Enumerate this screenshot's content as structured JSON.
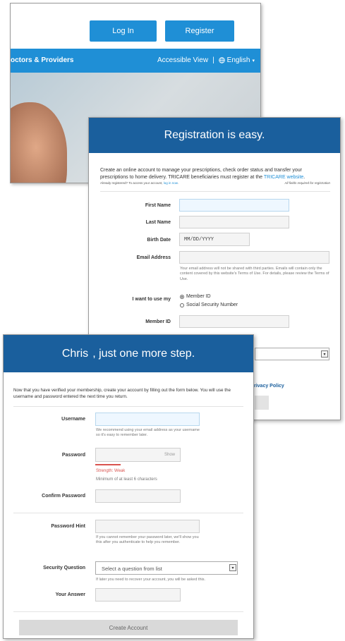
{
  "header": {
    "login_label": "Log In",
    "register_label": "Register",
    "nav_left": "octors & Providers",
    "accessible_view": "Accessible View",
    "separator": "|",
    "language": "English",
    "globe_icon": "globe-icon",
    "caret_icon": "caret-down-icon",
    "brand_color": "#1f8fd6"
  },
  "registration": {
    "title": "Registration is easy.",
    "intro_1": "Create an online account to manage your prescriptions, check order status and transfer your prescriptions to home delivery. TRICARE beneficiaries must register at the",
    "intro_link": "TRICARE website",
    "already": "Already registered? To access your account,",
    "login_now": "log in now",
    "required_note": "All fields required for registration",
    "first_name_label": "First Name",
    "last_name_label": "Last Name",
    "birth_date_label": "Birth Date",
    "birth_date_placeholder": "MM/DD/YYYY",
    "email_label": "Email Address",
    "email_hint": "Your email address will not be shared with third parties. Emails will contain only the content covered by this website's Terms of Use. For details, please review the Terms of Use.",
    "use_label": "I want to use my",
    "option_member": "Member ID",
    "option_ssn": "Social Security Number",
    "member_id_label": "Member ID",
    "privacy_link": "rivacy Policy",
    "header_color": "#1a5f9d"
  },
  "step": {
    "name": "Chris",
    "title_rest": ", just one more step.",
    "intro": "Now that you have verified your membership, create your account by filling out the form below. You will use the username and password entered the next time you return.",
    "username_label": "Username",
    "username_hint": "We recommend using your email address as your username so it's easy to remember later.",
    "password_label": "Password",
    "show_label": "Show",
    "strength_label": "Strength: Weak",
    "strength_color": "#d9534f",
    "min_chars": "Minimum of at least 6 characters",
    "confirm_label": "Confirm Password",
    "hint_label": "Password Hint",
    "hint_help": "If you cannot remember your password later, we'll show you this after you authenticate to help you remember.",
    "security_label": "Security Question",
    "security_placeholder": "Select a question from list",
    "security_help": "If later you need to recover your account, you will be asked this.",
    "answer_label": "Your Answer",
    "create_label": "Create Account"
  }
}
